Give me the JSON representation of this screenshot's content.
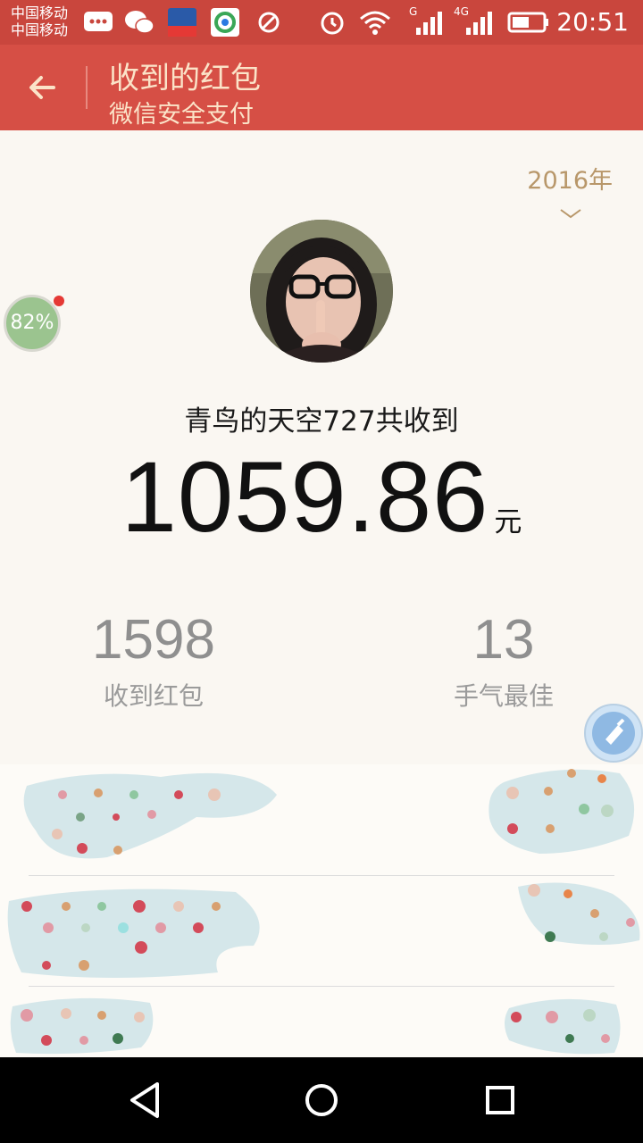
{
  "status_bar": {
    "carrier_1": "中国移动",
    "carrier_2": "中国移动",
    "network_1": "G",
    "network_2": "4G",
    "time": "20:51",
    "icons": [
      "message-icon",
      "wechat-icon",
      "app-icon",
      "browser-icon",
      "wrench-icon",
      "alarm-icon",
      "wifi-icon",
      "signal-icon",
      "signal-icon",
      "battery-icon"
    ]
  },
  "header": {
    "title": "收到的红包",
    "subtitle": "微信安全支付",
    "back_icon": "arrow-left-icon"
  },
  "year_selector": {
    "value": "2016年",
    "icon": "chevron-down-icon"
  },
  "floating_badge": {
    "value": "82%"
  },
  "summary": {
    "user_line": "青鸟的天空727共收到",
    "amount": "1059.86",
    "unit": "元"
  },
  "stats": [
    {
      "value": "1598",
      "label": "收到红包"
    },
    {
      "value": "13",
      "label": "手气最佳"
    }
  ],
  "nav_bar": {
    "icons": [
      "back-triangle-icon",
      "home-circle-icon",
      "recents-square-icon"
    ]
  },
  "colors": {
    "status_bar": "#c9463d",
    "title_bar": "#d64f45",
    "title_text": "#fbe3c8",
    "year_text": "#b8976a",
    "stat_text": "#8f8f8f"
  }
}
